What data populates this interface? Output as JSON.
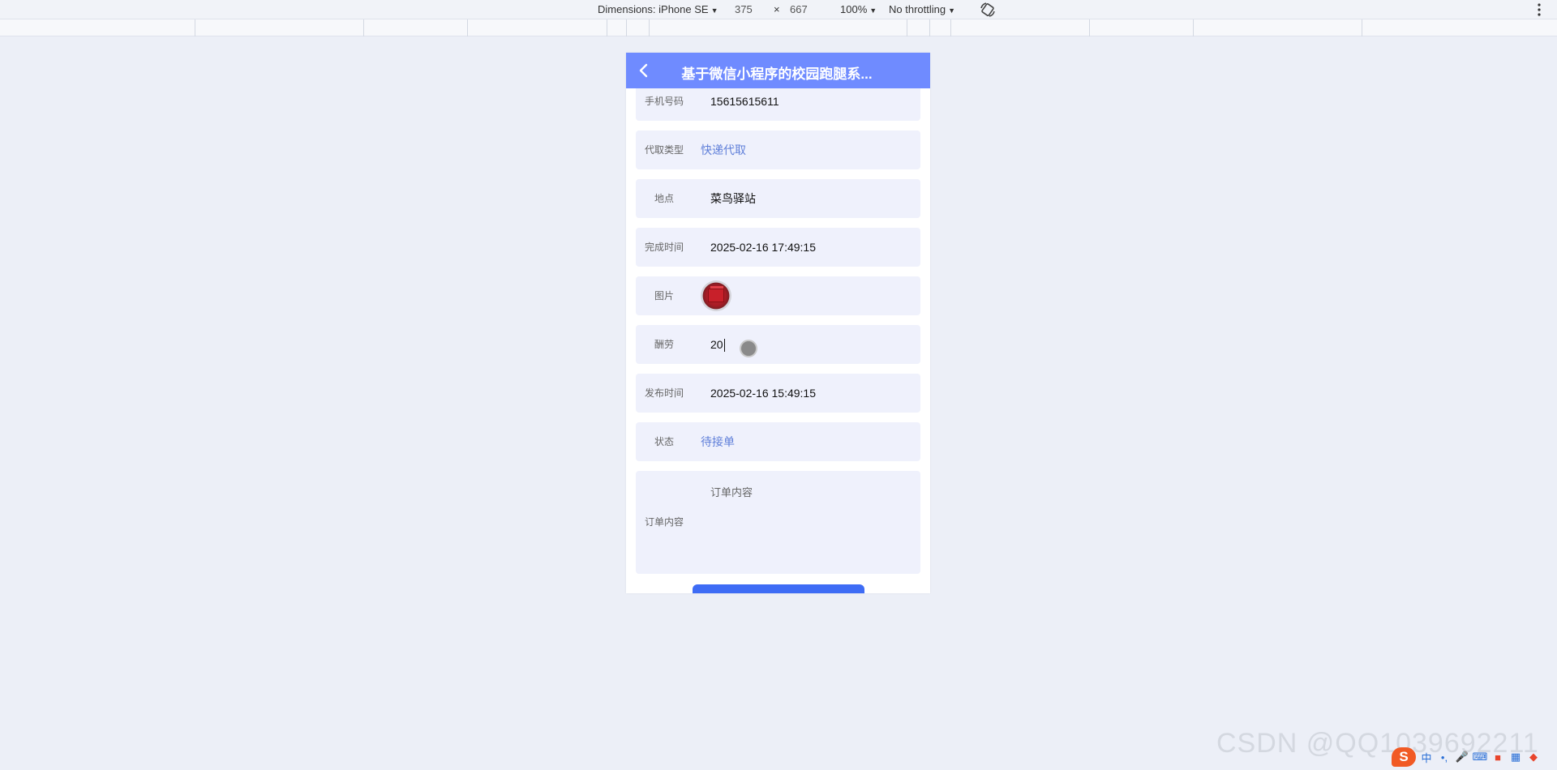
{
  "devtools": {
    "dimensions_label": "Dimensions: iPhone SE",
    "width": "375",
    "times": "×",
    "height": "667",
    "zoom": "100%",
    "throttling": "No throttling"
  },
  "nav": {
    "title": "基于微信小程序的校园跑腿系..."
  },
  "form": {
    "phone": {
      "label": "手机号码",
      "value": "15615615611"
    },
    "type": {
      "label": "代取类型",
      "value": "快递代取"
    },
    "location": {
      "label": "地点",
      "value": "菜鸟驿站"
    },
    "finish_time": {
      "label": "完成时间",
      "value": "2025-02-16 17:49:15"
    },
    "image": {
      "label": "图片"
    },
    "reward": {
      "label": "酬劳",
      "value": "20"
    },
    "publish_time": {
      "label": "发布时间",
      "value": "2025-02-16 15:49:15"
    },
    "status": {
      "label": "状态",
      "value": "待接单"
    },
    "content": {
      "label": "订单内容",
      "placeholder": "订单内容"
    }
  },
  "watermark": "CSDN @QQ1039692211",
  "tray": {
    "ime": "中",
    "punct": "•,"
  },
  "colors": {
    "nav": "#6f8bff",
    "row_bg": "#eff1fc",
    "link": "#5f7fd9",
    "button": "#3e6cf5"
  }
}
